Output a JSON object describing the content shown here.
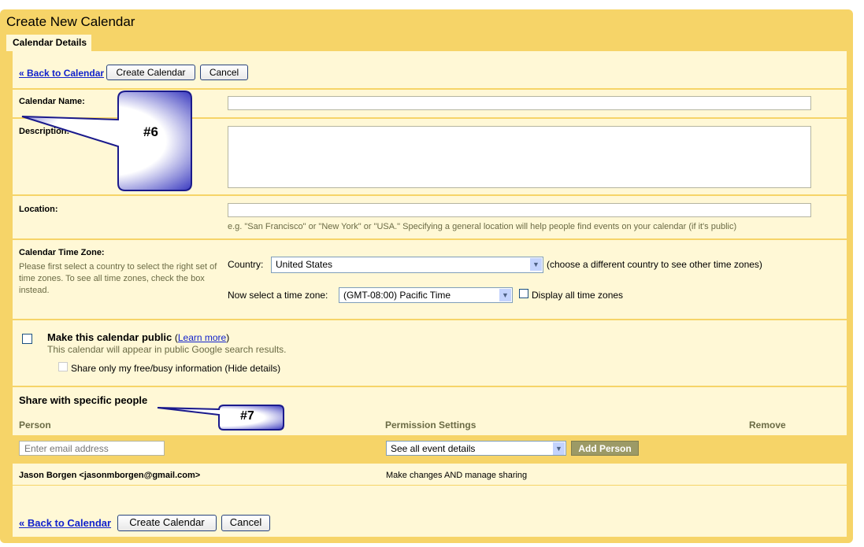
{
  "header": {
    "title": "Create New Calendar",
    "tab": "Calendar Details"
  },
  "toolbar": {
    "back": "« Back to Calendar",
    "create": "Create Calendar",
    "cancel": "Cancel"
  },
  "form": {
    "name_label": "Calendar Name:",
    "name_value": "",
    "description_label": "Description:",
    "description_value": "",
    "location_label": "Location:",
    "location_value": "",
    "location_hint": "e.g. \"San Francisco\" or \"New York\" or \"USA.\" Specifying a general location will help people find events on your calendar (if it's public)",
    "timezone_label": "Calendar Time Zone:",
    "timezone_hint": "Please first select a country to select the right set of time zones. To see all time zones, check the box instead.",
    "country_label": "Country:",
    "country_value": "United States",
    "country_hint": "(choose a different country to see other time zones)",
    "tz_label": "Now select a time zone:",
    "tz_value": "(GMT-08:00) Pacific Time",
    "all_tz_label": "Display all time zones",
    "all_tz_checked": false,
    "public_label": "Make this calendar public",
    "public_checked": false,
    "learn_more": "Learn more",
    "public_hint": "This calendar will appear in public Google search results.",
    "freebusy_label": "Share only my free/busy information (Hide details)",
    "freebusy_checked": false
  },
  "share": {
    "title": "Share with specific people",
    "columns": [
      "Person",
      "Permission Settings",
      "Remove"
    ],
    "email_placeholder": "Enter email address",
    "permission_value": "See all event details",
    "add_button": "Add Person",
    "rows": [
      {
        "person": "Jason Borgen <jasonmborgen@gmail.com>",
        "permission": "Make changes AND manage sharing"
      }
    ]
  },
  "callouts": [
    "#6",
    "#7"
  ],
  "colors": {
    "frame": "#f6d468",
    "panel": "#fff8d6",
    "callout": "#1a1a8c",
    "link": "#1122cc"
  }
}
